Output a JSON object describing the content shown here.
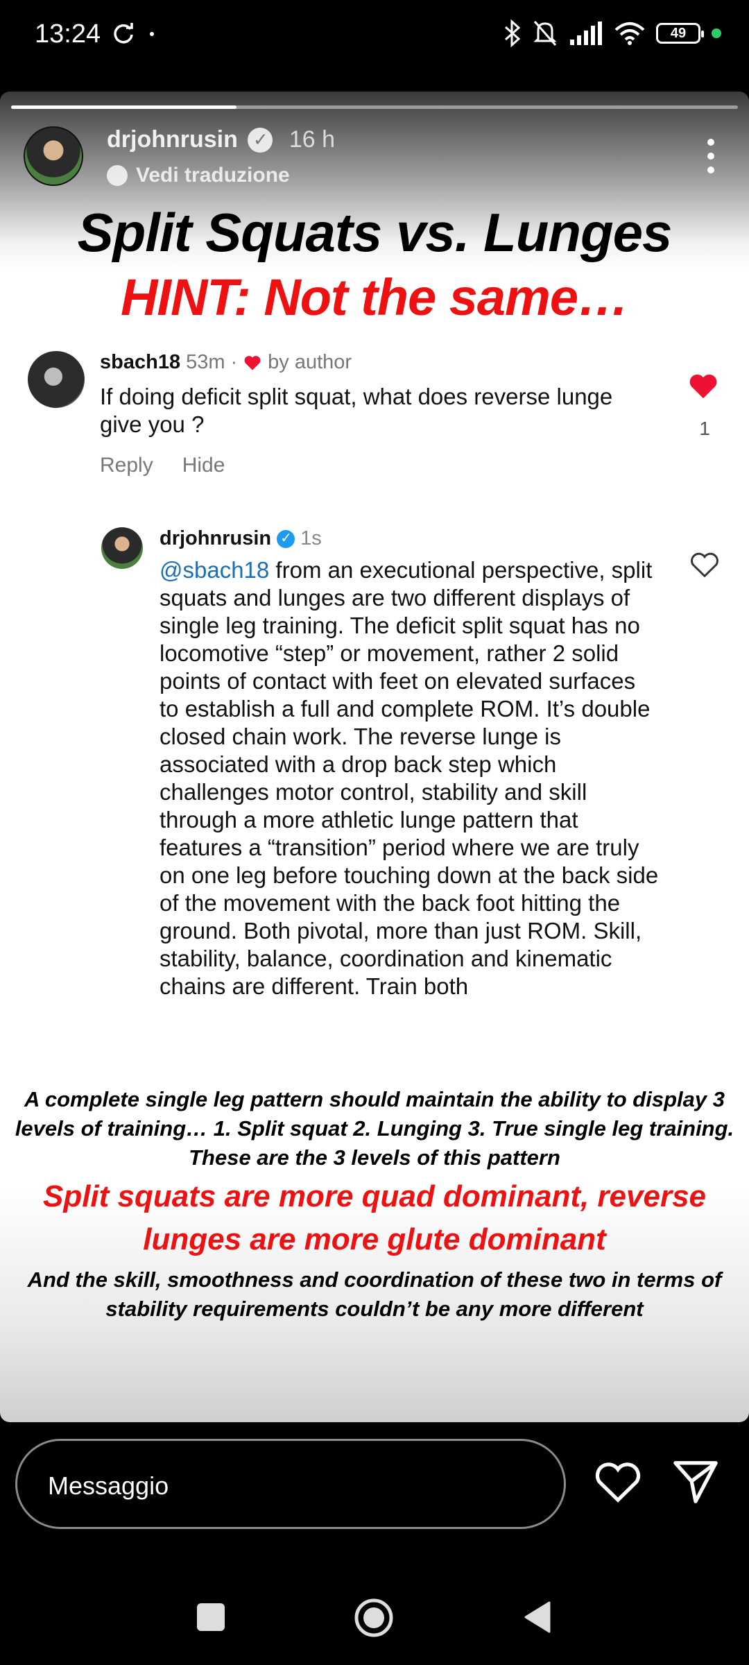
{
  "status_bar": {
    "time": "13:24",
    "battery": "49",
    "icons": [
      "sync-icon",
      "bluetooth-icon",
      "bell-muted-icon",
      "signal-icon",
      "wifi-icon",
      "battery-icon"
    ]
  },
  "story": {
    "progress": 0.31,
    "username": "drjohnrusin",
    "time_ago": "16 h",
    "translate_label": "Vedi traduzione",
    "headline": "Split Squats vs. Lunges",
    "subheadline": "HINT: Not the same…",
    "comment": {
      "username": "sbach18",
      "time": "53m",
      "liked_by_author": "by author",
      "text": "If doing deficit split squat, what does reverse lunge give you ?",
      "reply_label": "Reply",
      "hide_label": "Hide",
      "like_count": "1"
    },
    "reply": {
      "username": "drjohnrusin",
      "time": "1s",
      "mention": "@sbach18",
      "text": " from an executional perspective, split squats and lunges are two different displays of single leg training. The deficit split squat has no locomotive “step” or movement, rather 2 solid points of contact with feet on elevated surfaces to establish a full and complete ROM. It’s double closed chain work. The reverse lunge is associated with a drop back step which challenges motor control, stability and skill through a more athletic lunge pattern that features a “transition” period where we are truly on one leg before touching down at the back side of the movement with the back foot hitting the ground. Both pivotal, more than just ROM. Skill, stability, balance, coordination and kinematic chains are different. Train both"
    },
    "bottom_text_1": "A complete single leg pattern should maintain the ability to display 3 levels of training… 1. Split squat 2. Lunging 3. True single leg training. These are the 3 levels of this pattern",
    "bottom_text_2": "Split squats are more quad dominant, reverse lunges are more glute dominant",
    "bottom_text_3": "And the skill, smoothness and coordination of these two in terms of stability requirements couldn’t be any more different"
  },
  "message_bar": {
    "placeholder": "Messaggio"
  },
  "colors": {
    "accent_red": "#ee1111",
    "like_red": "#ee1133",
    "verified_blue": "#1d9bf0",
    "mention_blue": "#1a6fb5"
  }
}
